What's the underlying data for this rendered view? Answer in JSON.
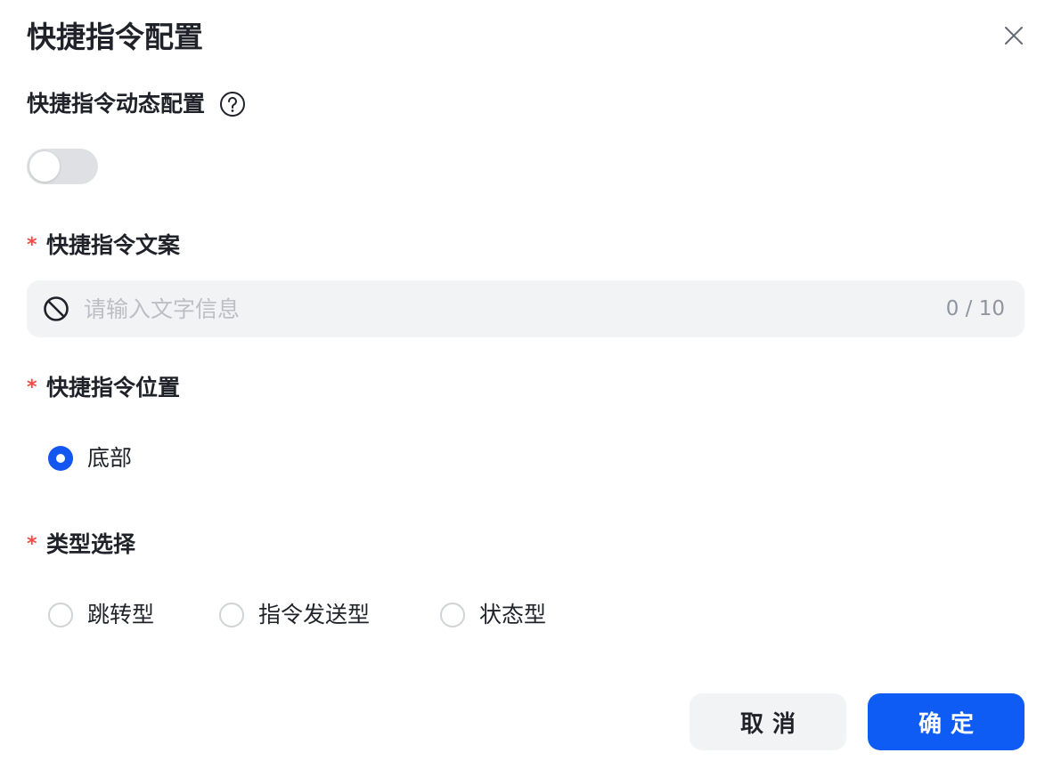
{
  "dialog": {
    "title": "快捷指令配置"
  },
  "dynamic_config": {
    "label": "快捷指令动态配置",
    "help_icon": "question-circle-icon",
    "enabled": false
  },
  "text_field": {
    "label": "快捷指令文案",
    "required": "*",
    "placeholder": "请输入文字信息",
    "value": "",
    "char_count": "0 / 10",
    "state_icon": "disabled-icon"
  },
  "position": {
    "label": "快捷指令位置",
    "required": "*",
    "options": [
      {
        "label": "底部",
        "checked": true
      }
    ]
  },
  "type_select": {
    "label": "类型选择",
    "required": "*",
    "options": [
      {
        "label": "跳转型",
        "checked": false
      },
      {
        "label": "指令发送型",
        "checked": false
      },
      {
        "label": "状态型",
        "checked": false
      }
    ]
  },
  "footer": {
    "cancel_label": "取消",
    "confirm_label": "确定"
  },
  "colors": {
    "primary": "#0f5cf5",
    "required_star": "#f54a45",
    "toggle_off": "#dee0e3",
    "input_bg": "#f2f3f5"
  }
}
